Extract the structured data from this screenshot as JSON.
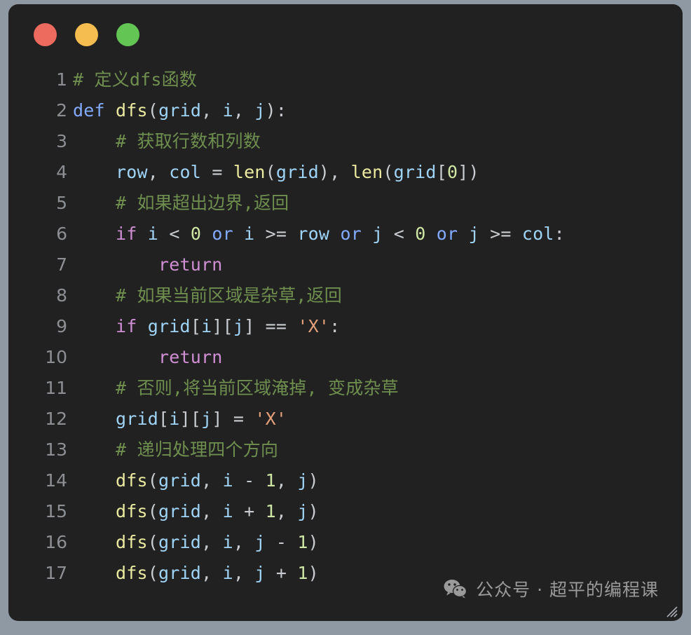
{
  "window": {
    "traffic_lights": [
      {
        "name": "close",
        "color": "#ec6a5e"
      },
      {
        "name": "minimize",
        "color": "#f5bd4f"
      },
      {
        "name": "zoom",
        "color": "#62c554"
      }
    ],
    "background": "#212121",
    "desktop_background": "#8e99a3"
  },
  "editor": {
    "language": "python",
    "line_count": 17,
    "lines": [
      {
        "number": "1",
        "tokens": [
          {
            "cls": "t-comment",
            "text": "# 定义dfs函数"
          }
        ]
      },
      {
        "number": "2",
        "tokens": [
          {
            "cls": "t-kw",
            "text": "def"
          },
          {
            "cls": "t-plain",
            "text": " "
          },
          {
            "cls": "t-fn",
            "text": "dfs"
          },
          {
            "cls": "t-punct",
            "text": "("
          },
          {
            "cls": "t-var",
            "text": "grid"
          },
          {
            "cls": "t-punct",
            "text": ", "
          },
          {
            "cls": "t-var",
            "text": "i"
          },
          {
            "cls": "t-punct",
            "text": ", "
          },
          {
            "cls": "t-var",
            "text": "j"
          },
          {
            "cls": "t-punct",
            "text": "):"
          }
        ]
      },
      {
        "number": "3",
        "tokens": [
          {
            "cls": "t-comment",
            "text": "    # 获取行数和列数"
          }
        ]
      },
      {
        "number": "4",
        "tokens": [
          {
            "cls": "t-plain",
            "text": "    "
          },
          {
            "cls": "t-var",
            "text": "row"
          },
          {
            "cls": "t-punct",
            "text": ", "
          },
          {
            "cls": "t-var",
            "text": "col"
          },
          {
            "cls": "t-punct",
            "text": " = "
          },
          {
            "cls": "t-fn",
            "text": "len"
          },
          {
            "cls": "t-punct",
            "text": "("
          },
          {
            "cls": "t-var",
            "text": "grid"
          },
          {
            "cls": "t-punct",
            "text": "), "
          },
          {
            "cls": "t-fn",
            "text": "len"
          },
          {
            "cls": "t-punct",
            "text": "("
          },
          {
            "cls": "t-var",
            "text": "grid"
          },
          {
            "cls": "t-punct",
            "text": "["
          },
          {
            "cls": "t-num",
            "text": "0"
          },
          {
            "cls": "t-punct",
            "text": "])"
          }
        ]
      },
      {
        "number": "5",
        "tokens": [
          {
            "cls": "t-comment",
            "text": "    # 如果超出边界,返回"
          }
        ]
      },
      {
        "number": "6",
        "tokens": [
          {
            "cls": "t-plain",
            "text": "    "
          },
          {
            "cls": "t-ctrl",
            "text": "if"
          },
          {
            "cls": "t-plain",
            "text": " "
          },
          {
            "cls": "t-var",
            "text": "i"
          },
          {
            "cls": "t-punct",
            "text": " < "
          },
          {
            "cls": "t-num",
            "text": "0"
          },
          {
            "cls": "t-plain",
            "text": " "
          },
          {
            "cls": "t-op-kw",
            "text": "or"
          },
          {
            "cls": "t-plain",
            "text": " "
          },
          {
            "cls": "t-var",
            "text": "i"
          },
          {
            "cls": "t-punct",
            "text": " >= "
          },
          {
            "cls": "t-var",
            "text": "row"
          },
          {
            "cls": "t-plain",
            "text": " "
          },
          {
            "cls": "t-op-kw",
            "text": "or"
          },
          {
            "cls": "t-plain",
            "text": " "
          },
          {
            "cls": "t-var",
            "text": "j"
          },
          {
            "cls": "t-punct",
            "text": " < "
          },
          {
            "cls": "t-num",
            "text": "0"
          },
          {
            "cls": "t-plain",
            "text": " "
          },
          {
            "cls": "t-op-kw",
            "text": "or"
          },
          {
            "cls": "t-plain",
            "text": " "
          },
          {
            "cls": "t-var",
            "text": "j"
          },
          {
            "cls": "t-punct",
            "text": " >= "
          },
          {
            "cls": "t-var",
            "text": "col"
          },
          {
            "cls": "t-punct",
            "text": ":"
          }
        ]
      },
      {
        "number": "7",
        "tokens": [
          {
            "cls": "t-plain",
            "text": "        "
          },
          {
            "cls": "t-ctrl",
            "text": "return"
          }
        ]
      },
      {
        "number": "8",
        "tokens": [
          {
            "cls": "t-comment",
            "text": "    # 如果当前区域是杂草,返回"
          }
        ]
      },
      {
        "number": "9",
        "tokens": [
          {
            "cls": "t-plain",
            "text": "    "
          },
          {
            "cls": "t-ctrl",
            "text": "if"
          },
          {
            "cls": "t-plain",
            "text": " "
          },
          {
            "cls": "t-var",
            "text": "grid"
          },
          {
            "cls": "t-punct",
            "text": "["
          },
          {
            "cls": "t-var",
            "text": "i"
          },
          {
            "cls": "t-punct",
            "text": "]["
          },
          {
            "cls": "t-var",
            "text": "j"
          },
          {
            "cls": "t-punct",
            "text": "] == "
          },
          {
            "cls": "t-str",
            "text": "'X'"
          },
          {
            "cls": "t-punct",
            "text": ":"
          }
        ]
      },
      {
        "number": "10",
        "tokens": [
          {
            "cls": "t-plain",
            "text": "        "
          },
          {
            "cls": "t-ctrl",
            "text": "return"
          }
        ]
      },
      {
        "number": "11",
        "tokens": [
          {
            "cls": "t-comment",
            "text": "    # 否则,将当前区域淹掉, 变成杂草"
          }
        ]
      },
      {
        "number": "12",
        "tokens": [
          {
            "cls": "t-plain",
            "text": "    "
          },
          {
            "cls": "t-var",
            "text": "grid"
          },
          {
            "cls": "t-punct",
            "text": "["
          },
          {
            "cls": "t-var",
            "text": "i"
          },
          {
            "cls": "t-punct",
            "text": "]["
          },
          {
            "cls": "t-var",
            "text": "j"
          },
          {
            "cls": "t-punct",
            "text": "] = "
          },
          {
            "cls": "t-str",
            "text": "'X'"
          }
        ]
      },
      {
        "number": "13",
        "tokens": [
          {
            "cls": "t-comment",
            "text": "    # 递归处理四个方向"
          }
        ]
      },
      {
        "number": "14",
        "tokens": [
          {
            "cls": "t-plain",
            "text": "    "
          },
          {
            "cls": "t-fn",
            "text": "dfs"
          },
          {
            "cls": "t-punct",
            "text": "("
          },
          {
            "cls": "t-var",
            "text": "grid"
          },
          {
            "cls": "t-punct",
            "text": ", "
          },
          {
            "cls": "t-var",
            "text": "i"
          },
          {
            "cls": "t-punct",
            "text": " - "
          },
          {
            "cls": "t-num",
            "text": "1"
          },
          {
            "cls": "t-punct",
            "text": ", "
          },
          {
            "cls": "t-var",
            "text": "j"
          },
          {
            "cls": "t-punct",
            "text": ")"
          }
        ]
      },
      {
        "number": "15",
        "tokens": [
          {
            "cls": "t-plain",
            "text": "    "
          },
          {
            "cls": "t-fn",
            "text": "dfs"
          },
          {
            "cls": "t-punct",
            "text": "("
          },
          {
            "cls": "t-var",
            "text": "grid"
          },
          {
            "cls": "t-punct",
            "text": ", "
          },
          {
            "cls": "t-var",
            "text": "i"
          },
          {
            "cls": "t-punct",
            "text": " + "
          },
          {
            "cls": "t-num",
            "text": "1"
          },
          {
            "cls": "t-punct",
            "text": ", "
          },
          {
            "cls": "t-var",
            "text": "j"
          },
          {
            "cls": "t-punct",
            "text": ")"
          }
        ]
      },
      {
        "number": "16",
        "tokens": [
          {
            "cls": "t-plain",
            "text": "    "
          },
          {
            "cls": "t-fn",
            "text": "dfs"
          },
          {
            "cls": "t-punct",
            "text": "("
          },
          {
            "cls": "t-var",
            "text": "grid"
          },
          {
            "cls": "t-punct",
            "text": ", "
          },
          {
            "cls": "t-var",
            "text": "i"
          },
          {
            "cls": "t-punct",
            "text": ", "
          },
          {
            "cls": "t-var",
            "text": "j"
          },
          {
            "cls": "t-punct",
            "text": " - "
          },
          {
            "cls": "t-num",
            "text": "1"
          },
          {
            "cls": "t-punct",
            "text": ")"
          }
        ]
      },
      {
        "number": "17",
        "tokens": [
          {
            "cls": "t-plain",
            "text": "    "
          },
          {
            "cls": "t-fn",
            "text": "dfs"
          },
          {
            "cls": "t-punct",
            "text": "("
          },
          {
            "cls": "t-var",
            "text": "grid"
          },
          {
            "cls": "t-punct",
            "text": ", "
          },
          {
            "cls": "t-var",
            "text": "i"
          },
          {
            "cls": "t-punct",
            "text": ", "
          },
          {
            "cls": "t-var",
            "text": "j"
          },
          {
            "cls": "t-punct",
            "text": " + "
          },
          {
            "cls": "t-num",
            "text": "1"
          },
          {
            "cls": "t-punct",
            "text": ")"
          }
        ]
      }
    ]
  },
  "watermark": {
    "icon": "wechat-icon",
    "text": "公众号 · 超平的编程课",
    "color": "#9a9a9a"
  },
  "resize_grip": {
    "icon": "resize-grip-icon"
  }
}
